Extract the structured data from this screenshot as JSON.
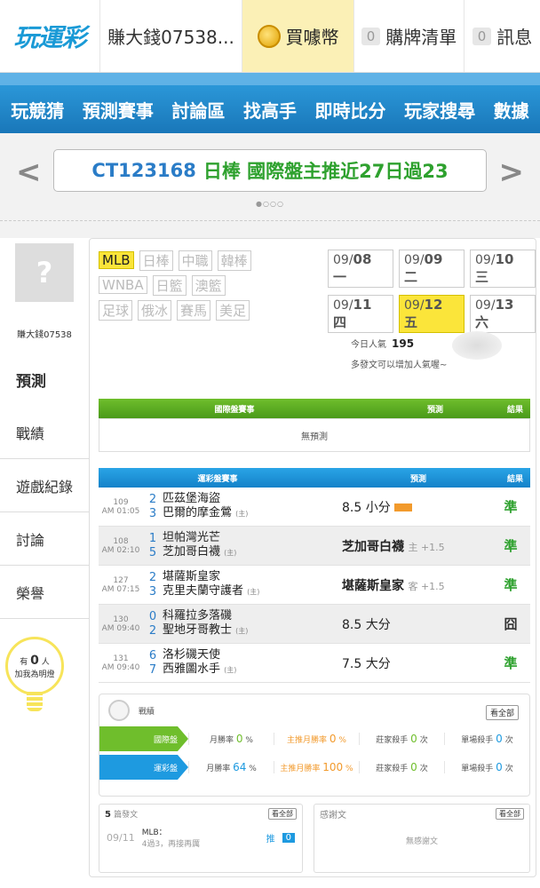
{
  "header": {
    "logo": "玩運彩",
    "username": "賺大錢07538...",
    "buy_label": "買噱幣",
    "cart_count": "0",
    "cart_label": "購牌清單",
    "msg_count": "0",
    "msg_label": "訊息"
  },
  "nav": [
    "玩競猜",
    "預測賽事",
    "討論區",
    "找高手",
    "即時比分",
    "玩家搜尋",
    "數據"
  ],
  "banner": {
    "code": "CT123168",
    "text": "日棒 國際盤主推近27日過23",
    "dots": "●○○○"
  },
  "sidebar": {
    "username": "賺大錢07538",
    "tabs": [
      "預測",
      "戰績",
      "遊戲紀錄",
      "討論",
      "榮譽"
    ],
    "bulb_count": "0",
    "bulb_prefix": "有",
    "bulb_unit": "人",
    "bulb_text": "加我為明燈"
  },
  "leagues": {
    "row1": [
      "MLB",
      "日棒",
      "中職",
      "韓棒"
    ],
    "row2": [
      "WNBA",
      "日籃",
      "澳籃"
    ],
    "row3": [
      "足球",
      "俄冰",
      "賽馬",
      "美足"
    ]
  },
  "dates": [
    {
      "m": "09/",
      "d": "08",
      "w": "一"
    },
    {
      "m": "09/",
      "d": "09",
      "w": "二"
    },
    {
      "m": "09/",
      "d": "10",
      "w": "三"
    },
    {
      "m": "09/",
      "d": "11",
      "w": "四"
    },
    {
      "m": "09/",
      "d": "12",
      "w": "五"
    },
    {
      "m": "09/",
      "d": "13",
      "w": "六"
    }
  ],
  "popularity": {
    "label": "今日人氣",
    "value": "195",
    "hint": "多發文可以增加人氣喔~"
  },
  "intl_table": {
    "col1": "國際盤賽事",
    "col2": "預測",
    "col3": "結果",
    "empty": "無預測"
  },
  "lottery_table": {
    "col1": "運彩盤賽事",
    "col2": "預測",
    "col3": "結果",
    "rows": [
      {
        "no": "109",
        "time": "AM 01:05",
        "s1": "2",
        "s2": "3",
        "t1": "匹茲堡海盜",
        "t2": "巴爾的摩金鶯",
        "home": "(主)",
        "pick": "8.5 小分",
        "extra": "",
        "res": "準",
        "win": true
      },
      {
        "no": "108",
        "time": "AM 02:10",
        "s1": "1",
        "s2": "5",
        "t1": "坦帕灣光芒",
        "t2": "芝加哥白襪",
        "home": "(主)",
        "pick": "芝加哥白襪",
        "extra": "主 +1.5",
        "res": "準",
        "win": true
      },
      {
        "no": "127",
        "time": "AM 07:15",
        "s1": "2",
        "s2": "3",
        "t1": "堪薩斯皇家",
        "t2": "克里夫蘭守護者",
        "home": "(主)",
        "pick": "堪薩斯皇家",
        "extra": "客 +1.5",
        "res": "準",
        "win": true
      },
      {
        "no": "130",
        "time": "AM 09:40",
        "s1": "0",
        "s2": "2",
        "t1": "科羅拉多落磯",
        "t2": "聖地牙哥教士",
        "home": "(主)",
        "pick": "8.5 大分",
        "extra": "",
        "res": "囧",
        "win": false
      },
      {
        "no": "131",
        "time": "AM 09:40",
        "s1": "6",
        "s2": "7",
        "t1": "洛杉磯天使",
        "t2": "西雅圖水手",
        "home": "(主)",
        "pick": "7.5 大分",
        "extra": "",
        "res": "準",
        "win": true
      }
    ]
  },
  "stats": {
    "title": "戰績",
    "all": "看全部",
    "rows": [
      {
        "label": "國際盤",
        "rate_label": "月勝率",
        "rate": "0",
        "main_label": "主推月勝率",
        "main": "0",
        "killer_label": "莊家殺手",
        "killer": "0",
        "sweep_label": "單場殺手",
        "sweep": "0"
      },
      {
        "label": "運彩盤",
        "rate_label": "月勝率",
        "rate": "64",
        "main_label": "主推月勝率",
        "main": "100",
        "killer_label": "莊家殺手",
        "killer": "0",
        "sweep_label": "單場殺手",
        "sweep": "0"
      }
    ],
    "unit_pct": "%",
    "unit_times": "次"
  },
  "posts": {
    "count": "5",
    "label": "篇發文",
    "all": "看全部",
    "m": "09",
    "d": "11",
    "title": "MLB：",
    "desc": "4過3，再接再厲",
    "push": "推",
    "push_count": "0"
  },
  "thanks": {
    "label": "感謝文",
    "all": "看全部",
    "empty": "無感謝文"
  }
}
